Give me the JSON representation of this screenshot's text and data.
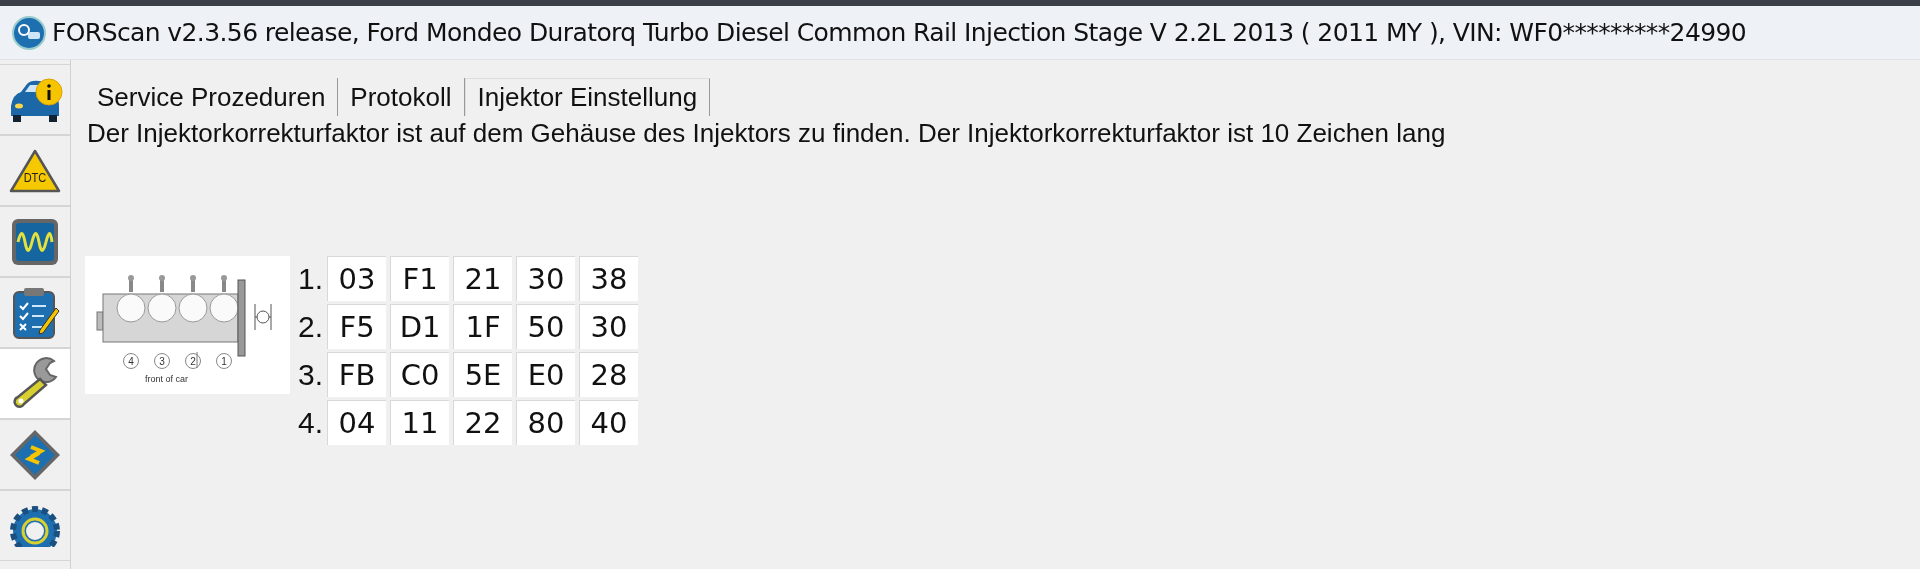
{
  "window": {
    "title": "FORScan v2.3.56 release, Ford Mondeo Duratorq Turbo Diesel Common Rail Injection Stage V 2.2L 2013 ( 2011 MY ), VIN: WF0*********24990"
  },
  "sidebar": {
    "items": [
      {
        "kind": "vehicle-info",
        "selected": false
      },
      {
        "kind": "dtc",
        "label": "DTC",
        "selected": false
      },
      {
        "kind": "oscilloscope",
        "selected": false
      },
      {
        "kind": "checklist",
        "selected": false
      },
      {
        "kind": "wrench",
        "selected": true
      },
      {
        "kind": "chip",
        "selected": false
      },
      {
        "kind": "gear",
        "selected": false
      }
    ]
  },
  "tabs": [
    {
      "label": "Service Prozeduren",
      "selected": false
    },
    {
      "label": "Protokoll",
      "selected": false
    },
    {
      "label": "Injektor Einstellung",
      "selected": true
    }
  ],
  "description": "Der Injektorkorrekturfaktor ist auf dem Gehäuse des Injektors zu finden. Der Injektorkorrekturfaktor ist 10 Zeichen lang",
  "diagram": {
    "cylinder_labels": [
      "4",
      "3",
      "2",
      "1"
    ],
    "caption": "front of car"
  },
  "injectors": [
    {
      "index": "1.",
      "codes": [
        "03",
        "F1",
        "21",
        "30",
        "38"
      ]
    },
    {
      "index": "2.",
      "codes": [
        "F5",
        "D1",
        "1F",
        "50",
        "30"
      ]
    },
    {
      "index": "3.",
      "codes": [
        "FB",
        "C0",
        "5E",
        "E0",
        "28"
      ]
    },
    {
      "index": "4.",
      "codes": [
        "04",
        "11",
        "22",
        "80",
        "40"
      ]
    }
  ]
}
